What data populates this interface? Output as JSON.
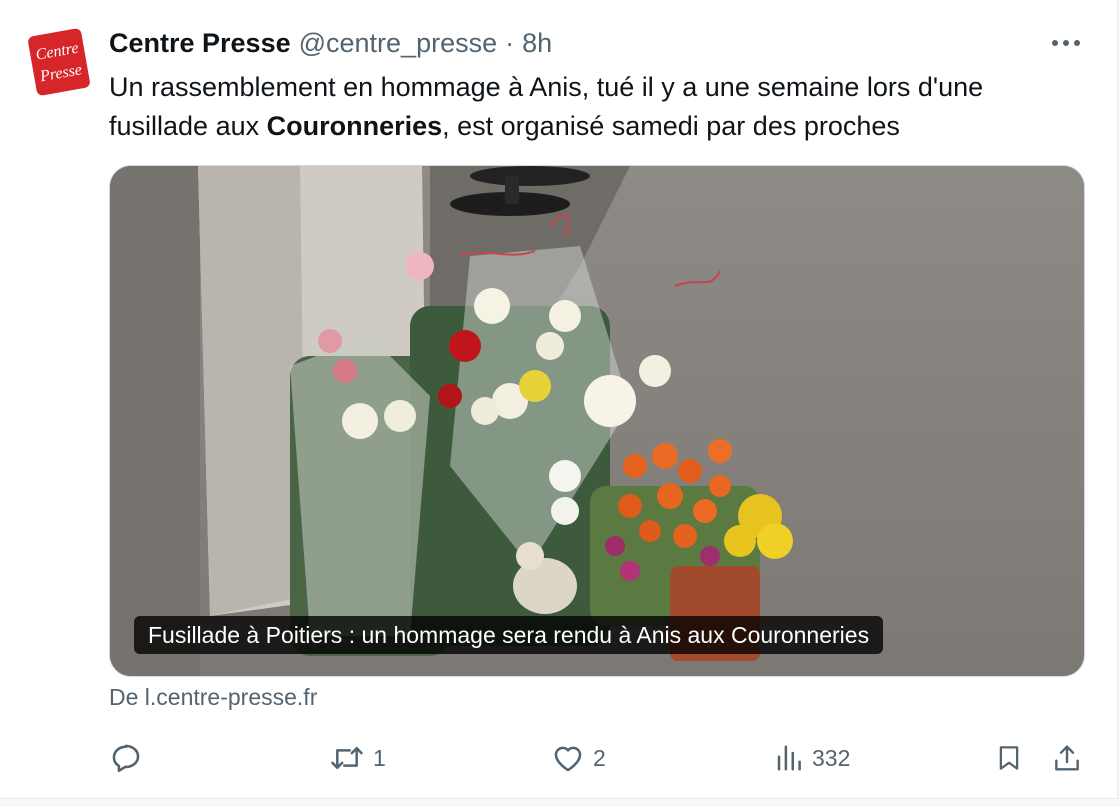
{
  "tweet": {
    "author_name": "Centre Presse",
    "handle": "@centre_presse",
    "separator": "·",
    "time": "8h",
    "avatar_text_line1": "Centre",
    "avatar_text_line2": "Presse",
    "text_part1": "Un rassemblement en hommage à Anis, tué il y a une semaine lors d'une fusillade aux ",
    "text_bold": "Couronneries",
    "text_part2": ", est organisé samedi par des proches",
    "more_icon": "more-horizontal-icon"
  },
  "card": {
    "caption": "Fusillade à Poitiers : un hommage sera rendu à Anis aux Couronneries",
    "source": "De l.centre-presse.fr"
  },
  "actions": {
    "reply_count": "",
    "retweet_count": "1",
    "like_count": "2",
    "views_count": "332",
    "icons": [
      "reply-icon",
      "retweet-icon",
      "like-icon",
      "views-icon",
      "bookmark-icon",
      "share-icon"
    ]
  },
  "colors": {
    "brand_red": "#d7262a",
    "text_primary": "#0f1419",
    "text_secondary": "#536471",
    "border": "#cfd9de"
  }
}
